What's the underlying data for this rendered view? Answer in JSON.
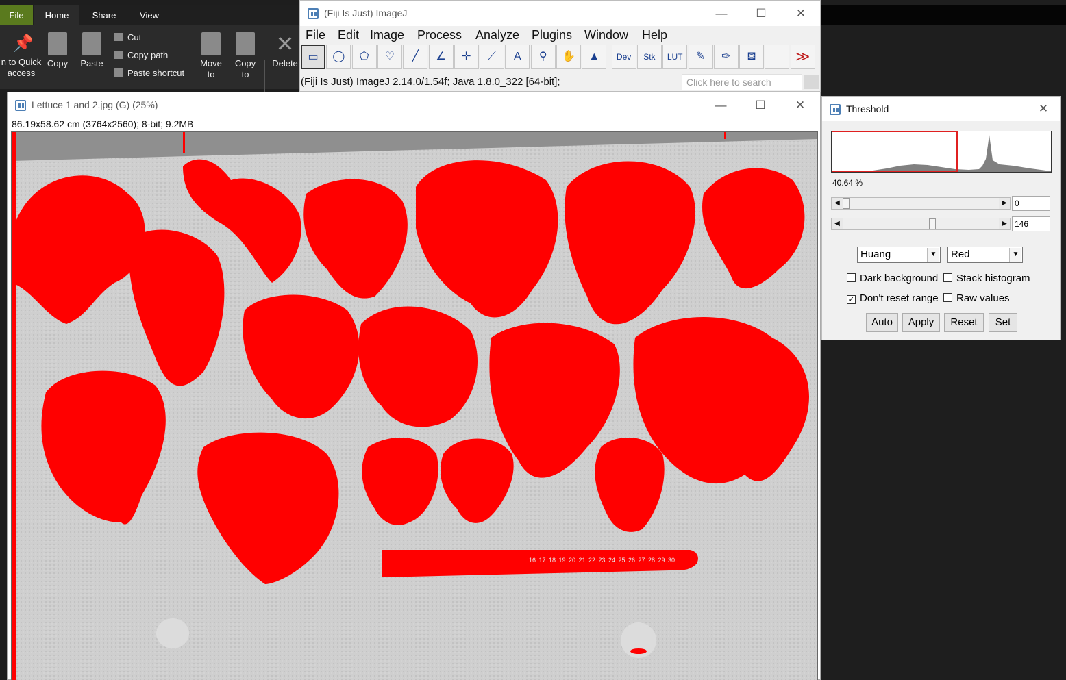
{
  "explorer": {
    "tabs": {
      "file": "File",
      "home": "Home",
      "share": "Share",
      "view": "View"
    },
    "buttons": {
      "pin_line1": "n to Quick",
      "pin_line2": "access",
      "copy": "Copy",
      "paste": "Paste",
      "cut": "Cut",
      "copy_path": "Copy path",
      "paste_shortcut": "Paste shortcut",
      "move_line1": "Move",
      "move_line2": "to",
      "copyto_line1": "Copy",
      "copyto_line2": "to",
      "delete": "Delete"
    }
  },
  "imagej": {
    "title": "(Fiji Is Just) ImageJ",
    "menus": [
      "File",
      "Edit",
      "Image",
      "Process",
      "Analyze",
      "Plugins",
      "Window",
      "Help"
    ],
    "tools": [
      {
        "name": "rectangle-tool",
        "glyph": "▭"
      },
      {
        "name": "oval-tool",
        "glyph": "◯"
      },
      {
        "name": "polygon-tool",
        "glyph": "⬠"
      },
      {
        "name": "freehand-tool",
        "glyph": "♡"
      },
      {
        "name": "line-tool",
        "glyph": "╱"
      },
      {
        "name": "angle-tool",
        "glyph": "∠"
      },
      {
        "name": "point-tool",
        "glyph": "✛"
      },
      {
        "name": "wand-tool",
        "glyph": "⟋"
      },
      {
        "name": "text-tool",
        "glyph": "A"
      },
      {
        "name": "magnifier-tool",
        "glyph": "⚲"
      },
      {
        "name": "hand-tool",
        "glyph": "✋"
      },
      {
        "name": "color-picker-tool",
        "glyph": "▲"
      },
      {
        "name": "dev-tool",
        "glyph": "Dev"
      },
      {
        "name": "stk-tool",
        "glyph": "Stk"
      },
      {
        "name": "lut-tool",
        "glyph": "LUT"
      },
      {
        "name": "pencil-tool",
        "glyph": "✎"
      },
      {
        "name": "brush-tool",
        "glyph": "✑"
      },
      {
        "name": "flood-fill-tool",
        "glyph": "⛾"
      },
      {
        "name": "empty-tool",
        "glyph": ""
      },
      {
        "name": "more-tools",
        "glyph": "≫"
      }
    ],
    "status": "(Fiji Is Just) ImageJ 2.14.0/1.54f; Java 1.8.0_322 [64-bit];",
    "search_placeholder": "Click here to search"
  },
  "image_window": {
    "title": "Lettuce 1 and 2.jpg (G) (25%)",
    "info": "86.19x58.62 cm (3764x2560); 8-bit; 9.2MB",
    "ruler_numbers": [
      "16",
      "17",
      "18",
      "19",
      "20",
      "21",
      "22",
      "23",
      "24",
      "25",
      "26",
      "27",
      "28",
      "29",
      "30"
    ]
  },
  "threshold": {
    "title": "Threshold",
    "percent": "40.64 %",
    "min_value": "0",
    "max_value": "146",
    "min_fraction": 0.0,
    "max_fraction": 0.573,
    "method": "Huang",
    "display": "Red",
    "checkboxes": {
      "dark_background": {
        "label": "Dark background",
        "checked": false
      },
      "stack_histogram": {
        "label": "Stack histogram",
        "checked": false
      },
      "dont_reset_range": {
        "label": "Don't reset range",
        "checked": true
      },
      "raw_values": {
        "label": "Raw values",
        "checked": false
      }
    },
    "buttons": {
      "auto": "Auto",
      "apply": "Apply",
      "reset": "Reset",
      "set": "Set"
    }
  },
  "colors": {
    "threshold_red": "#ff0000",
    "explorer_file_tab": "#5a7a1e",
    "imagej_blue": "#1a3f8f"
  }
}
